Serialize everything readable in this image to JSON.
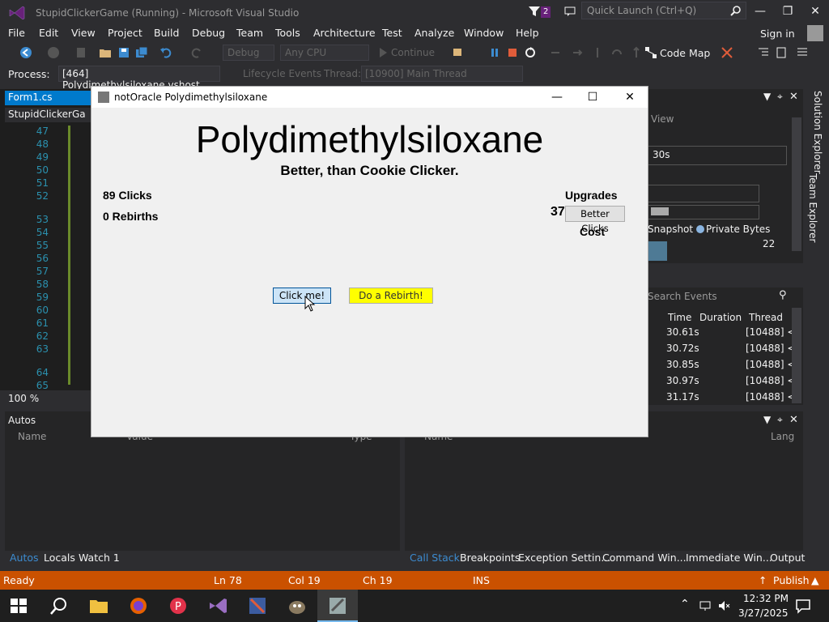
{
  "vs": {
    "title": "StupidClickerGame (Running) - Microsoft Visual Studio",
    "notification_count": "2",
    "quick_launch_placeholder": "Quick Launch (Ctrl+Q)",
    "menu": [
      "File",
      "Edit",
      "View",
      "Project",
      "Build",
      "Debug",
      "Team",
      "Tools",
      "Architecture",
      "Test",
      "Analyze",
      "Window",
      "Help"
    ],
    "sign_in": "Sign in",
    "toolbar": {
      "config": "Debug",
      "platform": "Any CPU",
      "continue": "Continue",
      "code_map": "Code Map"
    },
    "process_label": "Process:",
    "process_value": "[464] Polydimethylsiloxane.vshost",
    "lifecycle_events": "Lifecycle Events",
    "thread_label": "Thread:",
    "thread_value": "[10900] Main Thread",
    "doc_tab": "Form1.cs",
    "nav_combo": "StupidClickerGa",
    "line_numbers": [
      "47",
      "48",
      "49",
      "50",
      "51",
      "52",
      "53",
      "54",
      "55",
      "56",
      "57",
      "58",
      "59",
      "60",
      "61",
      "62",
      "63",
      "64",
      "65"
    ],
    "zoom": "100 %",
    "diagnostics": {
      "view": "View",
      "timeline": "30s",
      "snapshot": "Snapshot",
      "private_bytes": "Private Bytes",
      "value": "22"
    },
    "events": {
      "search": "Search Events",
      "cols": [
        "Time",
        "Duration",
        "Thread"
      ],
      "rows": [
        {
          "time": "30.61s",
          "thread": "[10488] <"
        },
        {
          "time": "30.72s",
          "thread": "[10488] <"
        },
        {
          "time": "30.85s",
          "thread": "[10488] <"
        },
        {
          "time": "30.97s",
          "thread": "[10488] <"
        },
        {
          "time": "31.17s",
          "thread": "[10488] <"
        }
      ]
    },
    "solution_explorer": "Solution Explorer",
    "team_explorer": "Team Explorer",
    "autos": {
      "title": "Autos",
      "cols": [
        "Name",
        "Value",
        "Type"
      ]
    },
    "callstack": {
      "cols": [
        "Name",
        "Lang"
      ]
    },
    "bottom_tabs_left": [
      "Autos",
      "Locals",
      "Watch 1"
    ],
    "bottom_tabs_right": [
      "Call Stack",
      "Breakpoints",
      "Exception Settin...",
      "Command Win...",
      "Immediate Win...",
      "Output"
    ],
    "status": {
      "ready": "Ready",
      "ln": "Ln 78",
      "col": "Col 19",
      "ch": "Ch 19",
      "ins": "INS",
      "publish": "Publish"
    }
  },
  "taskbar": {
    "time": "12:32 PM",
    "date": "3/27/2025"
  },
  "dialog": {
    "title": "notOracle Polydimethylsiloxane",
    "game_title": "Polydimethylsiloxane",
    "subtitle": "Better, than Cookie Clicker.",
    "clicks": "89 Clicks",
    "rebirths": "0 Rebirths",
    "upgrades_label": "Upgrades",
    "upgrade_cost_value": "37",
    "better_clicks_btn": "Better Clicks",
    "cost_label": "Cost",
    "click_btn": "Click me!",
    "rebirth_btn": "Do a Rebirth!"
  },
  "colors": {
    "vs_bg": "#2d2d30",
    "accent": "#007acc",
    "status_bar": "#ca5100",
    "rebirth_btn": "#ffff00"
  }
}
